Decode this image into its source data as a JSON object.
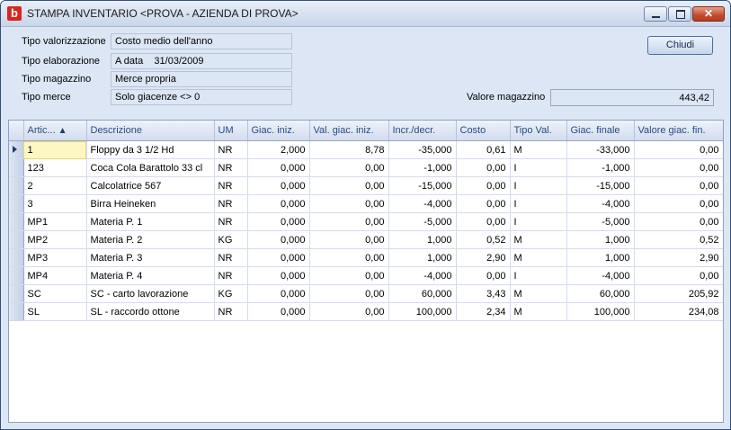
{
  "window": {
    "title": "STAMPA INVENTARIO <PROVA - AZIENDA DI PROVA>",
    "app_icon_letter": "b",
    "controls": {
      "minimize": "minimize-icon",
      "maximize": "maximize-icon",
      "close": "close-icon",
      "close_glyph": "✕"
    }
  },
  "filters": [
    {
      "label": "Tipo valorizzazione",
      "value": "Costo medio dell'anno"
    },
    {
      "label": "Tipo elaborazione",
      "value": "A data    31/03/2009"
    },
    {
      "label": "Tipo magazzino",
      "value": "Merce propria"
    },
    {
      "label": "Tipo merce",
      "value": "Solo giacenze <> 0"
    }
  ],
  "close_button_label": "Chiudi",
  "valore_magazzino": {
    "label": "Valore magazzino",
    "value": "443,42"
  },
  "grid": {
    "columns": [
      "Artic...",
      "Descrizione",
      "UM",
      "Giac. iniz.",
      "Val. giac. iniz.",
      "Incr./decr.",
      "Costo",
      "Tipo Val.",
      "Giac. finale",
      "Valore giac. fin."
    ],
    "sort_icon": "sort-ascending-icon",
    "sort_glyph": "▲",
    "selected_row": 0,
    "rows": [
      [
        "1",
        "Floppy da 3 1/2 Hd",
        "NR",
        "2,000",
        "8,78",
        "-35,000",
        "0,61",
        "M",
        "-33,000",
        "0,00"
      ],
      [
        "123",
        "Coca Cola Barattolo 33 cl",
        "NR",
        "0,000",
        "0,00",
        "-1,000",
        "0,00",
        "I",
        "-1,000",
        "0,00"
      ],
      [
        "2",
        "Calcolatrice 567",
        "NR",
        "0,000",
        "0,00",
        "-15,000",
        "0,00",
        "I",
        "-15,000",
        "0,00"
      ],
      [
        "3",
        "Birra Heineken",
        "NR",
        "0,000",
        "0,00",
        "-4,000",
        "0,00",
        "I",
        "-4,000",
        "0,00"
      ],
      [
        "MP1",
        "Materia P. 1",
        "NR",
        "0,000",
        "0,00",
        "-5,000",
        "0,00",
        "I",
        "-5,000",
        "0,00"
      ],
      [
        "MP2",
        "Materia P. 2",
        "KG",
        "0,000",
        "0,00",
        "1,000",
        "0,52",
        "M",
        "1,000",
        "0,52"
      ],
      [
        "MP3",
        "Materia P. 3",
        "NR",
        "0,000",
        "0,00",
        "1,000",
        "2,90",
        "M",
        "1,000",
        "2,90"
      ],
      [
        "MP4",
        "Materia P. 4",
        "NR",
        "0,000",
        "0,00",
        "-4,000",
        "0,00",
        "I",
        "-4,000",
        "0,00"
      ],
      [
        "SC",
        "SC - carto lavorazione",
        "KG",
        "0,000",
        "0,00",
        "60,000",
        "3,43",
        "M",
        "60,000",
        "205,92"
      ],
      [
        "SL",
        "SL - raccordo ottone",
        "NR",
        "0,000",
        "0,00",
        "100,000",
        "2,34",
        "M",
        "100,000",
        "234,08"
      ]
    ]
  }
}
